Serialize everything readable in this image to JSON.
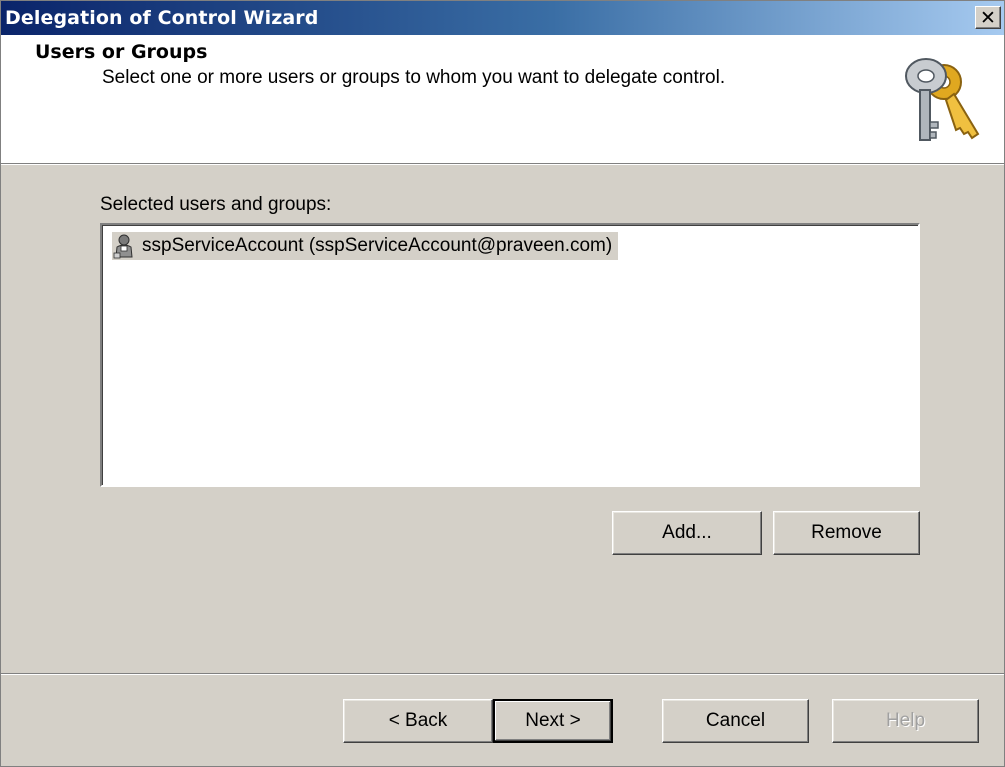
{
  "window": {
    "title": "Delegation of Control Wizard",
    "close_glyph": "✕"
  },
  "header": {
    "title": "Users or Groups",
    "subtitle": "Select one or more users or groups to whom you want to delegate control.",
    "icon": "keys-icon"
  },
  "list": {
    "label": "Selected users and groups:",
    "items": [
      {
        "icon": "user-icon",
        "text": "sspServiceAccount (sspServiceAccount@praveen.com)",
        "selected": true
      }
    ]
  },
  "buttons": {
    "add": "Add...",
    "remove": "Remove",
    "back": "< Back",
    "next": "Next >",
    "cancel": "Cancel",
    "help": "Help"
  },
  "colors": {
    "titlebar_start": "#0a246a",
    "titlebar_end": "#a6caf0",
    "dialog_bg": "#d4d0c8",
    "header_bg": "#ffffff",
    "selection_bg": "#d4d0c8"
  }
}
